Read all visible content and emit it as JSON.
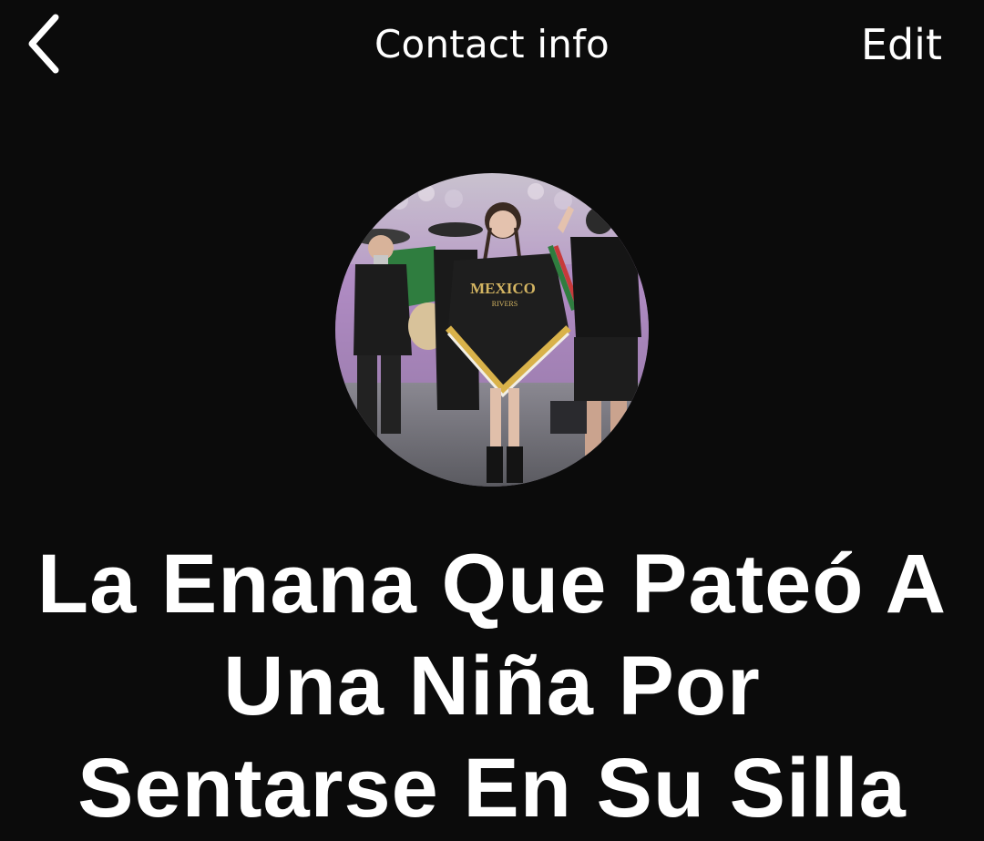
{
  "nav": {
    "back_icon": "chevron-left-icon",
    "title": "Contact info",
    "edit_label": "Edit"
  },
  "avatar": {
    "shirt_text": "MEXICO",
    "shirt_subtext": "RIVERS"
  },
  "contact": {
    "name": "La Enana Que Pateó A Una Niña Por Sentarse En Su Silla"
  },
  "colors": {
    "background": "#0b0b0b",
    "text": "#ffffff"
  }
}
